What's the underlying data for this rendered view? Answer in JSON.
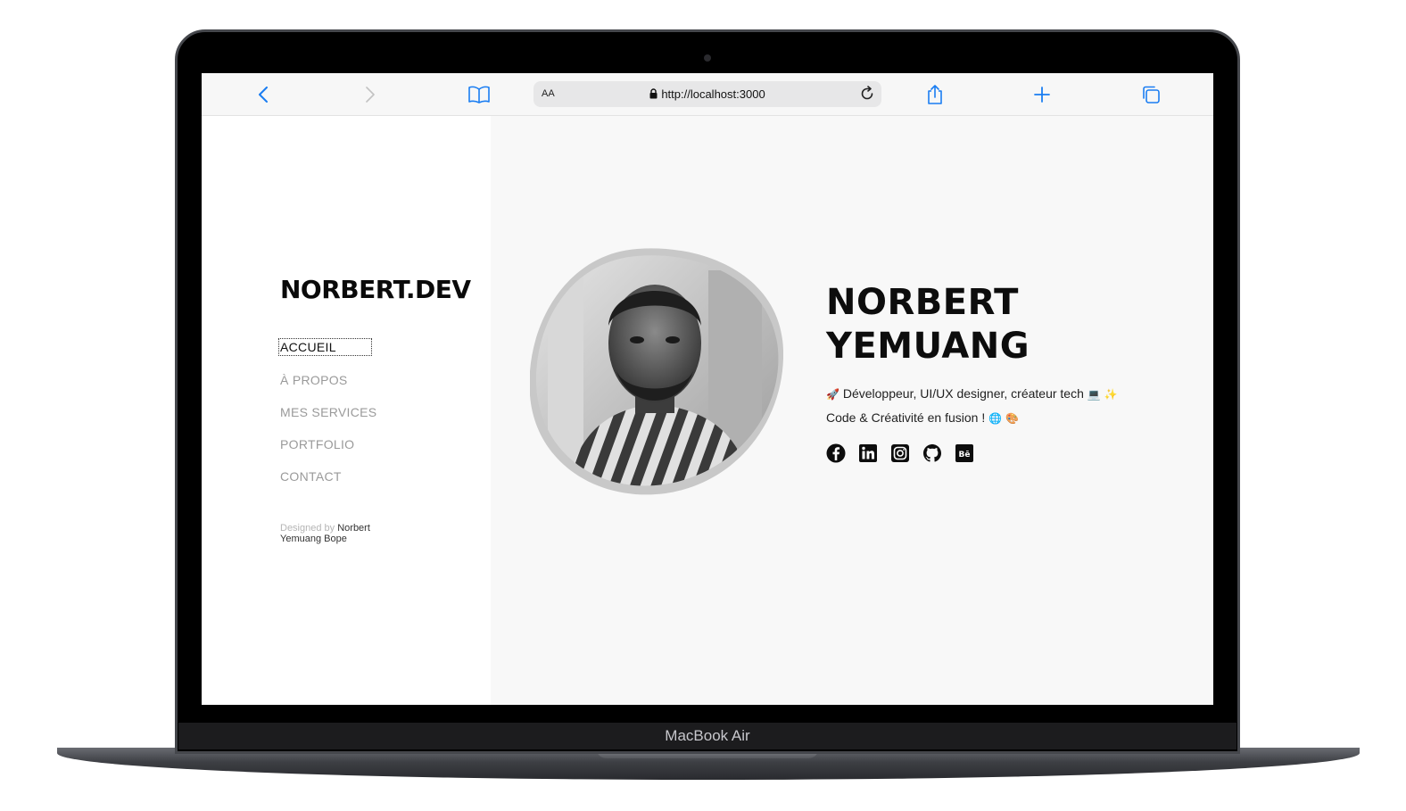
{
  "device": {
    "model_label": "MacBook Air"
  },
  "browser": {
    "aa_label": "AA",
    "url": "http://localhost:3000",
    "icons": [
      "back-icon",
      "forward-icon",
      "bookmarks-icon",
      "lock-icon",
      "reload-icon",
      "share-icon",
      "new-tab-icon",
      "tabs-icon"
    ]
  },
  "sidebar": {
    "brand": "NORBERT.DEV",
    "nav": [
      {
        "label": "ACCUEIL",
        "active": true
      },
      {
        "label": "À PROPOS"
      },
      {
        "label": "MES SERVICES"
      },
      {
        "label": "PORTFOLIO"
      },
      {
        "label": "CONTACT"
      }
    ],
    "credit_prefix": "Designed by",
    "credit_author": "Norbert Yemuang Bope"
  },
  "hero": {
    "name_line1": "NORBERT",
    "name_line2": "YEMUANG",
    "tagline_line1": "Développeur, UI/UX designer, créateur tech",
    "tagline_line2": "Code & Créativité en fusion !",
    "emoji": {
      "rocket": "🚀",
      "laptop": "💻",
      "sparkles": "✨",
      "globe": "🌐",
      "palette": "🎨"
    },
    "socials": [
      "facebook-icon",
      "linkedin-icon",
      "instagram-icon",
      "github-icon",
      "behance-icon"
    ]
  },
  "colors": {
    "accent_blue": "#1a7df2",
    "text_dark": "#0d0d0d",
    "nav_muted": "#9a9a9a",
    "main_bg": "#f8f8f8"
  }
}
